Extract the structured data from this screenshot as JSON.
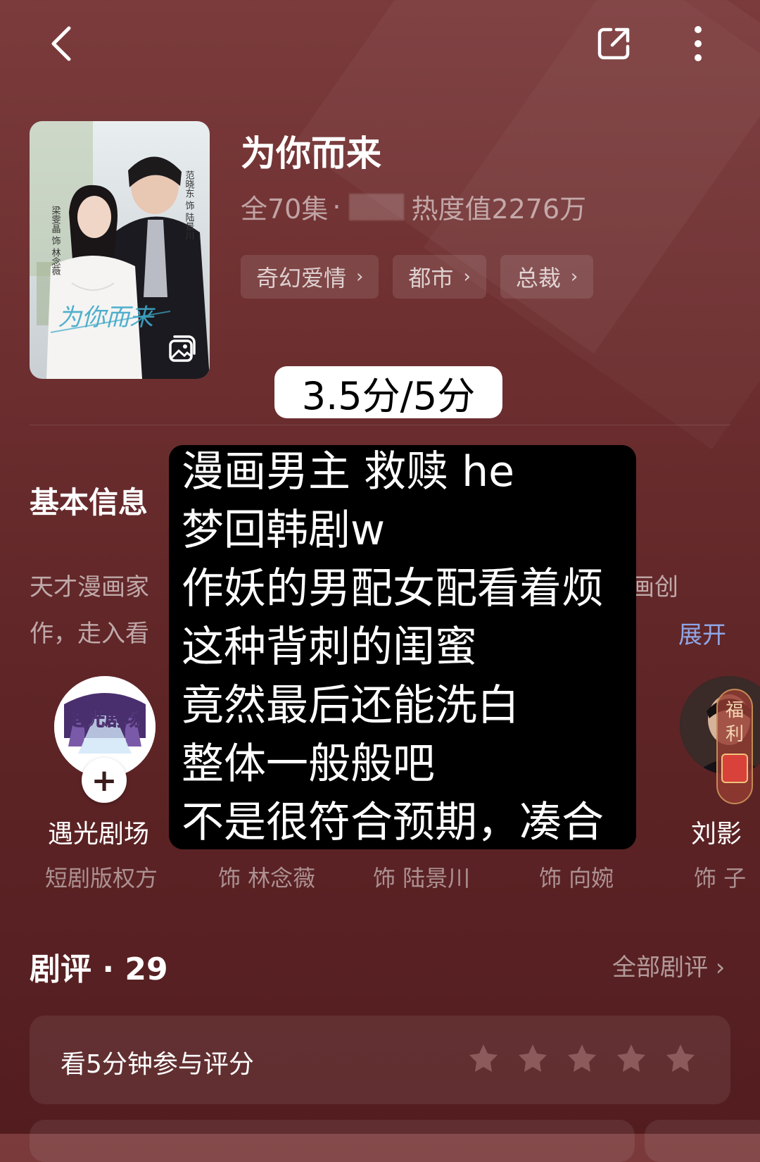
{
  "header": {
    "back_icon": "chevron-left-icon",
    "share_icon": "share-icon",
    "more_icon": "more-vertical-icon"
  },
  "drama": {
    "title": "为你而来",
    "episodes": "全70集",
    "separator": "·",
    "heat": "热度值2276万",
    "tags": [
      "奇幻爱情",
      "都市",
      "总裁"
    ],
    "poster_title_art": "为你而来",
    "poster_actors_left": "梁雯晶 饰 林念薇",
    "poster_actors_right": "范晓东 饰 陆景川"
  },
  "score_badge": "3.5分/5分",
  "basic_info": {
    "title": "基本信息",
    "synopsis_line1_start": "天才漫画家",
    "synopsis_line1_end": "画创",
    "synopsis_line2_start": "作，走入看",
    "expand": "展开"
  },
  "cast": [
    {
      "name": "遇光剧场",
      "role": "短剧版权方",
      "avatar_text": "遇光剧场"
    },
    {
      "name": "",
      "role": "饰 林念薇"
    },
    {
      "name": "",
      "role": "饰 陆景川"
    },
    {
      "name": "",
      "role": "饰 向婉"
    },
    {
      "name": "刘影",
      "role": "饰 子"
    }
  ],
  "welfare": {
    "line1": "福",
    "line2": "利"
  },
  "overlay_note": [
    "漫画男主 救赎 he",
    "梦回韩剧w",
    "作妖的男配女配看着烦",
    "这种背刺的闺蜜",
    "竟然最后还能洗白",
    "整体一般般吧",
    "不是很符合预期，凑合"
  ],
  "reviews": {
    "title": "剧评 · 29",
    "all_link": "全部剧评 ›",
    "rate_prompt": "看5分钟参与评分",
    "stars": 5,
    "rated": 0
  },
  "colors": {
    "background": "#6e2f30",
    "link": "#8fa6e6",
    "star_empty": "#8c5a5a"
  }
}
